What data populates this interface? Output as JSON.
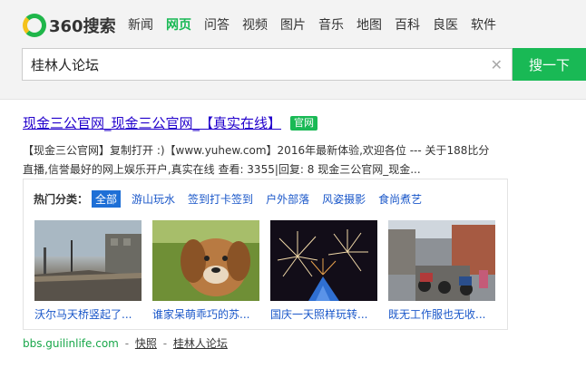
{
  "brand": {
    "logo_text": "360搜索"
  },
  "nav": {
    "items": [
      {
        "label": "新闻"
      },
      {
        "label": "网页"
      },
      {
        "label": "问答"
      },
      {
        "label": "视频"
      },
      {
        "label": "图片"
      },
      {
        "label": "音乐"
      },
      {
        "label": "地图"
      },
      {
        "label": "百科"
      },
      {
        "label": "良医"
      },
      {
        "label": "软件"
      }
    ],
    "active_index": 1
  },
  "search": {
    "query": "桂林人论坛",
    "button_label": "搜一下"
  },
  "result": {
    "title": "现金三公官网_现金三公官网_【真实在线】",
    "badge": "官网",
    "snippet_line1": "【现金三公官网】复制打开 :)【www.yuhew.com】2016年最新体验,欢迎各位 --- 关于188比分",
    "snippet_line2": "直播,信誉最好的网上娱乐开户,真实在线 查看: 3355|回复: 8 现金三公官网_现金..."
  },
  "categories": {
    "label": "热门分类：",
    "tabs": [
      {
        "label": "全部"
      },
      {
        "label": "游山玩水"
      },
      {
        "label": "签到打卡签到"
      },
      {
        "label": "户外部落"
      },
      {
        "label": "风姿摄影"
      },
      {
        "label": "食尚煮艺"
      }
    ],
    "active_index": 0
  },
  "thumbnails": [
    {
      "caption": "沃尔马天桥竖起了..."
    },
    {
      "caption": "谁家呆萌乖巧的苏..."
    },
    {
      "caption": "国庆一天照样玩转..."
    },
    {
      "caption": "既无工作服也无收..."
    }
  ],
  "footer": {
    "domain": "bbs.guilinlife.com",
    "sep1": "-",
    "snapshot": "快照",
    "sep2": "-",
    "site_name": "桂林人论坛"
  },
  "colors": {
    "brand_green": "#19b955",
    "link_blue": "#2200cc",
    "tab_blue": "#1e6fd6"
  }
}
